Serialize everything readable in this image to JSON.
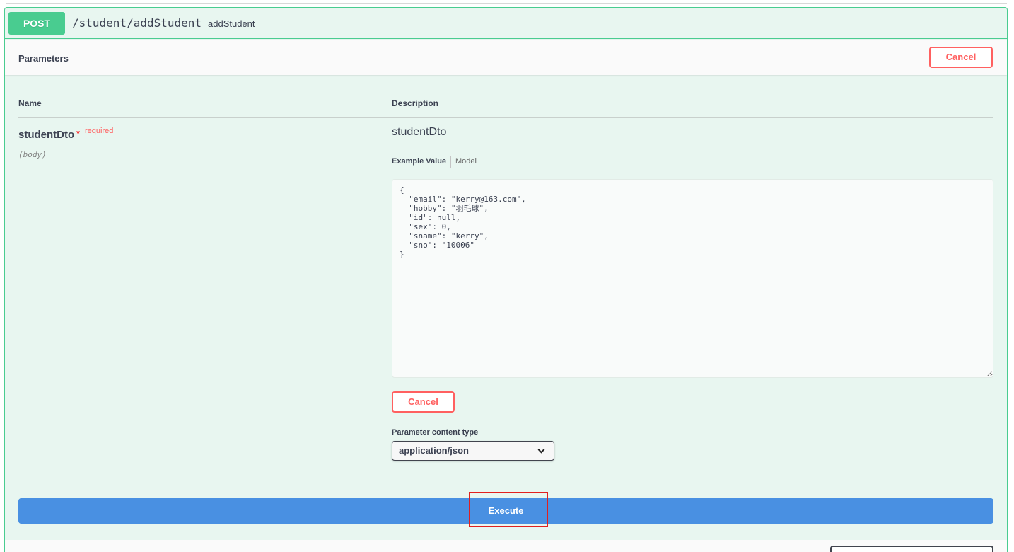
{
  "operation": {
    "method": "POST",
    "path": "/student/addStudent",
    "summary": "addStudent"
  },
  "parameters_section": {
    "title": "Parameters",
    "cancel_label": "Cancel"
  },
  "table": {
    "name_header": "Name",
    "description_header": "Description"
  },
  "parameter": {
    "name": "studentDto",
    "required_star": "*",
    "required_label": "required",
    "location": "(body)",
    "description": "studentDto",
    "tabs": {
      "example_value": "Example Value",
      "model": "Model"
    },
    "body_value": "{\n  \"email\": \"kerry@163.com\",\n  \"hobby\": \"羽毛球\",\n  \"id\": null,\n  \"sex\": 0,\n  \"sname\": \"kerry\",\n  \"sno\": \"10006\"\n}",
    "cancel_label": "Cancel",
    "content_type_label": "Parameter content type",
    "content_type_value": "application/json"
  },
  "execute": {
    "label": "Execute"
  },
  "colors": {
    "post_green": "#49cc90",
    "block_bg": "#e8f6f0",
    "cancel_red": "#ff6060",
    "execute_blue": "#4990e2",
    "highlight_red": "#e02020"
  }
}
